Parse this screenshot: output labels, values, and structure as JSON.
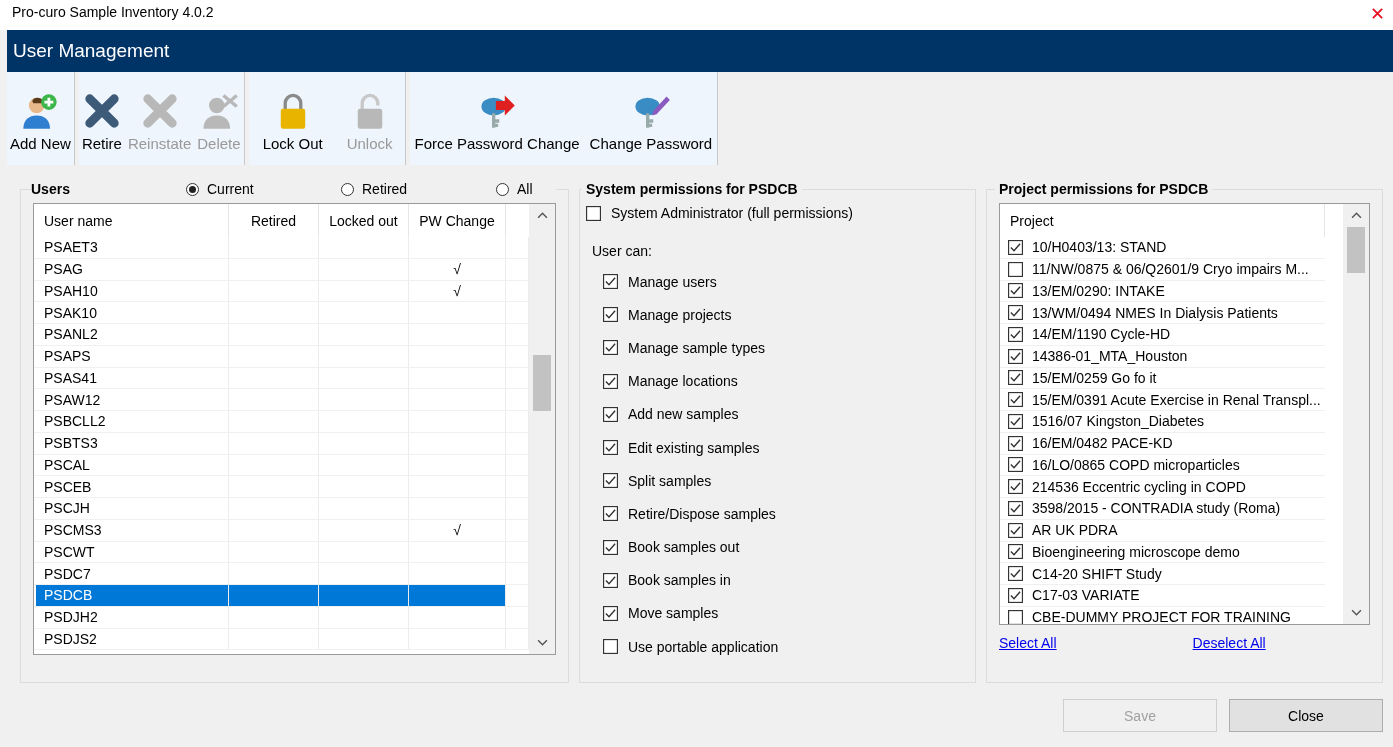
{
  "window": {
    "title": "Pro-curo Sample Inventory 4.0.2"
  },
  "header": {
    "title": "User Management"
  },
  "toolbar": {
    "groups": [
      {
        "buttons": [
          {
            "label": "Add New",
            "kind": "adduser",
            "disabled": false
          }
        ]
      },
      {
        "buttons": [
          {
            "label": "Retire",
            "kind": "cross",
            "disabled": false
          },
          {
            "label": "Reinstate",
            "kind": "cross",
            "disabled": true
          },
          {
            "label": "Delete",
            "kind": "removeuser",
            "disabled": true
          }
        ]
      },
      {
        "buttons": [
          {
            "label": "Lock Out",
            "kind": "lock",
            "disabled": false
          },
          {
            "label": "Unlock",
            "kind": "unlock",
            "disabled": true
          }
        ]
      },
      {
        "buttons": [
          {
            "label": "Force Password Change",
            "kind": "keyarrow",
            "disabled": false
          },
          {
            "label": "Change Password",
            "kind": "keypen",
            "disabled": false
          }
        ]
      }
    ]
  },
  "users": {
    "title": "Users",
    "filters": [
      {
        "label": "Current",
        "selected": true
      },
      {
        "label": "Retired",
        "selected": false
      },
      {
        "label": "All",
        "selected": false
      }
    ],
    "columns": [
      "User name",
      "Retired",
      "Locked out",
      "PW Change"
    ],
    "rows": [
      {
        "name": "PSAET3",
        "selected": false
      },
      {
        "name": "PSAG",
        "pw_change": "√",
        "selected": false
      },
      {
        "name": "PSAH10",
        "pw_change": "√",
        "selected": false
      },
      {
        "name": "PSAK10",
        "selected": false
      },
      {
        "name": "PSANL2",
        "selected": false
      },
      {
        "name": "PSAPS",
        "selected": false
      },
      {
        "name": "PSAS41",
        "selected": false
      },
      {
        "name": "PSAW12",
        "selected": false
      },
      {
        "name": "PSBCLL2",
        "selected": false
      },
      {
        "name": "PSBTS3",
        "selected": false
      },
      {
        "name": "PSCAL",
        "selected": false
      },
      {
        "name": "PSCEB",
        "selected": false
      },
      {
        "name": "PSCJH",
        "selected": false
      },
      {
        "name": "PSCMS3",
        "pw_change": "√",
        "selected": false
      },
      {
        "name": "PSCWT",
        "selected": false
      },
      {
        "name": "PSDC7",
        "selected": false
      },
      {
        "name": "PSDCB",
        "selected": true
      },
      {
        "name": "PSDJH2",
        "selected": false
      },
      {
        "name": "PSDJS2",
        "selected": false
      }
    ]
  },
  "system_permissions": {
    "title": "System permissions for PSDCB",
    "admin": {
      "label": "System Administrator (full permissions)",
      "checked": false
    },
    "subtitle": "User can:",
    "items": [
      {
        "label": "Manage users",
        "checked": true
      },
      {
        "label": "Manage projects",
        "checked": true
      },
      {
        "label": "Manage sample types",
        "checked": true
      },
      {
        "label": "Manage locations",
        "checked": true
      },
      {
        "label": "Add new samples",
        "checked": true
      },
      {
        "label": "Edit existing samples",
        "checked": true
      },
      {
        "label": "Split samples",
        "checked": true
      },
      {
        "label": "Retire/Dispose samples",
        "checked": true
      },
      {
        "label": "Book samples out",
        "checked": true
      },
      {
        "label": "Book samples in",
        "checked": true
      },
      {
        "label": "Move samples",
        "checked": true
      },
      {
        "label": "Use portable application",
        "checked": false
      }
    ]
  },
  "project_permissions": {
    "title": "Project permissions for PSDCB",
    "column": "Project",
    "items": [
      {
        "label": "10/H0403/13: STAND",
        "checked": true
      },
      {
        "label": "11/NW/0875 & 06/Q2601/9 Cryo impairs M...",
        "checked": false
      },
      {
        "label": "13/EM/0290: INTAKE",
        "checked": true
      },
      {
        "label": "13/WM/0494 NMES In Dialysis Patients",
        "checked": true
      },
      {
        "label": "14/EM/1190 Cycle-HD",
        "checked": true
      },
      {
        "label": "14386-01_MTA_Houston",
        "checked": true
      },
      {
        "label": "15/EM/0259 Go fo it",
        "checked": true
      },
      {
        "label": "15/EM/0391 Acute Exercise in Renal Transpl...",
        "checked": true
      },
      {
        "label": "1516/07 Kingston_Diabetes",
        "checked": true
      },
      {
        "label": "16/EM/0482 PACE-KD",
        "checked": true
      },
      {
        "label": "16/LO/0865 COPD microparticles",
        "checked": true
      },
      {
        "label": "214536 Eccentric cycling in COPD",
        "checked": true
      },
      {
        "label": "3598/2015 - CONTRADIA study (Roma)",
        "checked": true
      },
      {
        "label": "AR UK PDRA",
        "checked": true
      },
      {
        "label": "Bioengineering microscope demo",
        "checked": true
      },
      {
        "label": "C14-20 SHIFT Study",
        "checked": true
      },
      {
        "label": "C17-03 VARIATE",
        "checked": true
      },
      {
        "label": "CBE-DUMMY PROJECT FOR TRAINING",
        "checked": false
      }
    ],
    "links": [
      "Select All",
      "Deselect All"
    ]
  },
  "footer": {
    "buttons": [
      {
        "label": "Save",
        "disabled": true
      },
      {
        "label": "Close",
        "disabled": false
      }
    ]
  }
}
